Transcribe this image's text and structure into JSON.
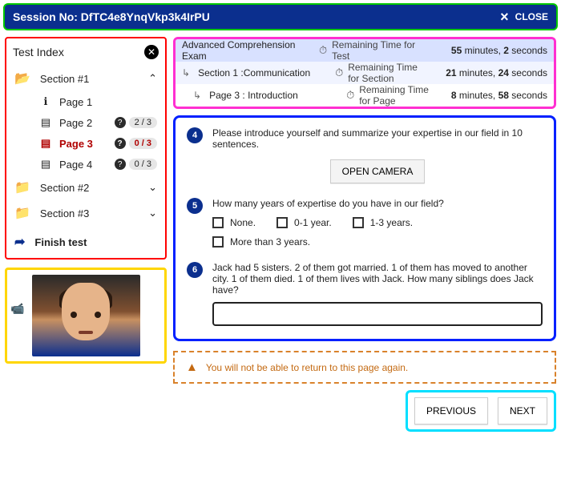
{
  "session": {
    "prefix": "Session No: ",
    "id": "DfTC4e8YnqVkp3k4IrPU",
    "close_label": "CLOSE"
  },
  "test_index": {
    "title": "Test Index",
    "sections": [
      {
        "label": "Section #1",
        "open": true
      },
      {
        "label": "Section #2",
        "open": false
      },
      {
        "label": "Section #3",
        "open": false
      }
    ],
    "pages": [
      {
        "label": "Page 1",
        "icon": "info",
        "counter": null
      },
      {
        "label": "Page 2",
        "icon": "doc",
        "counter": "2 / 3"
      },
      {
        "label": "Page 3",
        "icon": "doc",
        "counter": "0 / 3",
        "active": true
      },
      {
        "label": "Page 4",
        "icon": "doc",
        "counter": "0 / 3"
      }
    ],
    "finish_label": "Finish test"
  },
  "timers": {
    "row0": {
      "title": "Advanced Comprehension Exam",
      "label": "Remaining Time for Test",
      "min": "55",
      "sec": "2"
    },
    "row1": {
      "title": "Section 1  :Communication",
      "label": "Remaining Time for Section",
      "min": "21",
      "sec": "24"
    },
    "row2": {
      "title": "Page 3 : Introduction",
      "label": "Remaining Time for Page",
      "min": "8",
      "sec": "58"
    }
  },
  "timer_words": {
    "minutes": " minutes, ",
    "seconds": " seconds"
  },
  "questions": {
    "q4": {
      "num": "4",
      "text": "Please introduce yourself and summarize your expertise in our field in 10 sentences.",
      "button": "OPEN CAMERA"
    },
    "q5": {
      "num": "5",
      "text": "How many years of expertise do you have in our field?",
      "options": [
        "None.",
        "0-1 year.",
        "1-3 years.",
        "More than 3 years."
      ]
    },
    "q6": {
      "num": "6",
      "text": "Jack had 5 sisters. 2 of them got married. 1 of them has moved to another city. 1 of them died. 1 of them lives with Jack. How many siblings does Jack have?"
    }
  },
  "warning": "You will not be able to return to this page again.",
  "nav": {
    "prev": "PREVIOUS",
    "next": "NEXT"
  }
}
